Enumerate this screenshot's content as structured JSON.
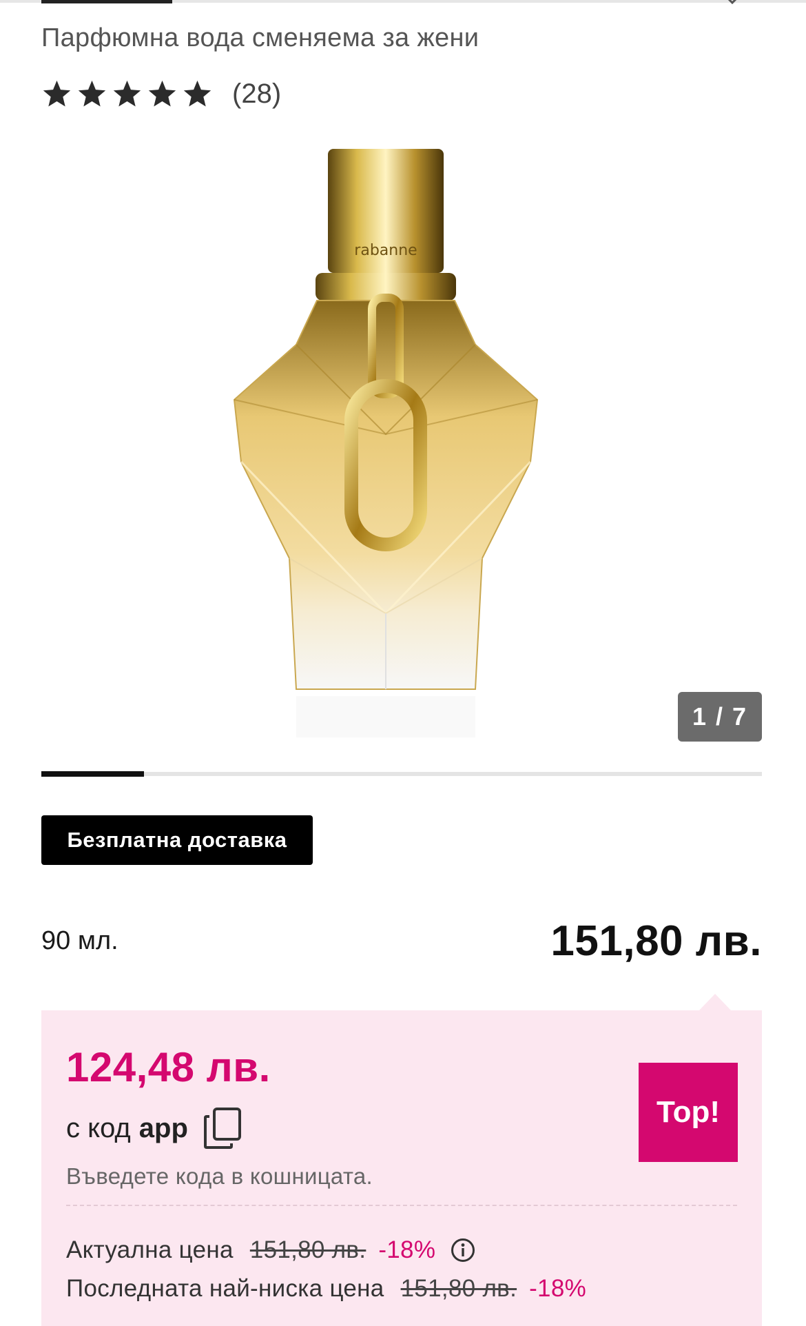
{
  "product": {
    "subtitle": "Парфюмна вода сменяема за жени",
    "rating": {
      "stars": 5,
      "max_stars": 5,
      "review_count": "(28)",
      "star_icon": "star-icon"
    },
    "gallery": {
      "counter": "1 / 7",
      "current": 1,
      "total": 7,
      "bottle_engraving": "rabanne"
    },
    "free_delivery_badge": "Безплатна доставка",
    "volume": "90 мл.",
    "price": "151,80 лв."
  },
  "promo": {
    "price": "124,48 лв.",
    "code_prefix": "с код",
    "code_value": "app",
    "copy_icon": "copy-icon",
    "code_hint": "Въведете кода в кошницата.",
    "top_badge": "Top!",
    "current_price_label": "Актуална цена",
    "current_price_old": "151,80 лв.",
    "current_price_discount": "-18%",
    "info_icon": "info-icon",
    "lowest_price_label": "Последната най-ниска цена",
    "lowest_price_old": "151,80 лв.",
    "lowest_price_discount": "-18%"
  },
  "colors": {
    "accent_pink": "#d4086f",
    "promo_background": "#fce7f0",
    "counter_background": "#6b6b6b",
    "badge_background": "#000000"
  }
}
